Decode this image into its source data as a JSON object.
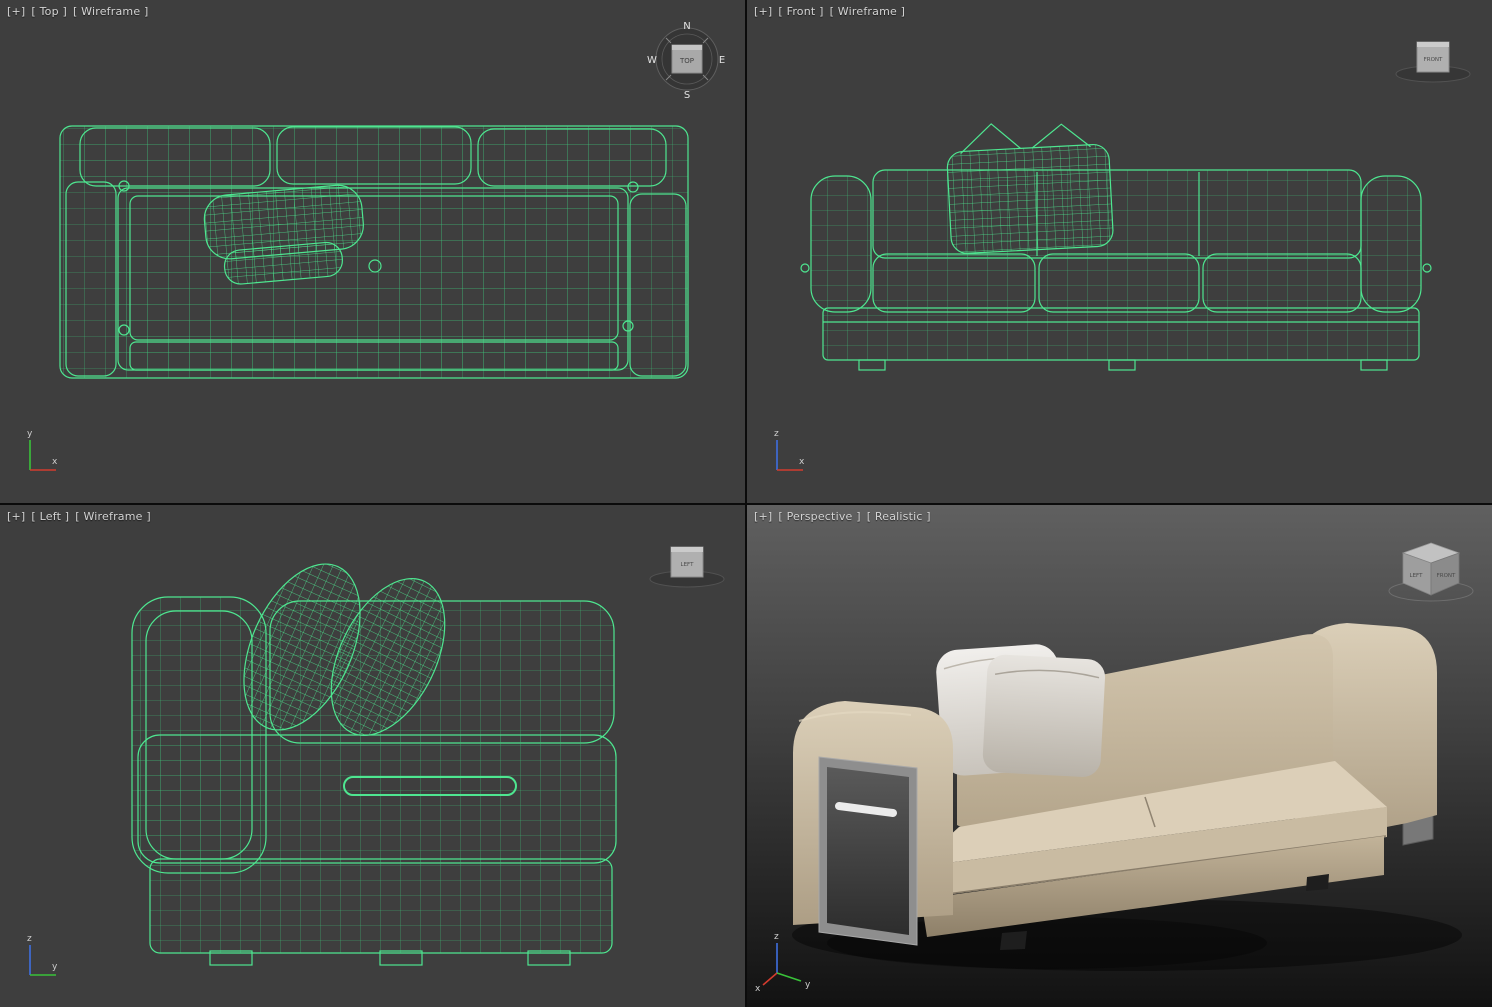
{
  "viewports": {
    "top": {
      "menu": "[+]",
      "view": "[ Top ]",
      "shading": "[ Wireframe ]"
    },
    "front": {
      "menu": "[+]",
      "view": "[ Front ]",
      "shading": "[ Wireframe ]"
    },
    "left": {
      "menu": "[+]",
      "view": "[ Left ]",
      "shading": "[ Wireframe ]"
    },
    "perspective": {
      "menu": "[+]",
      "view": "[ Perspective ]",
      "shading": "[ Realistic ]"
    }
  },
  "viewcube": {
    "top_face": "TOP",
    "front_face": "FRONT",
    "left_face": "LEFT",
    "persp_face_left": "LEFT",
    "persp_face_right": "FRONT",
    "compass": {
      "north": "N",
      "east": "E",
      "south": "S",
      "west": "W"
    }
  },
  "axes": {
    "x": "x",
    "y": "y",
    "z": "z"
  },
  "colors": {
    "wireframe_green": "#4ee690",
    "viewport_background": "#3e3e3e",
    "active_viewport_border": "#c09c35",
    "perspective_sky": "#5e5e5e",
    "sofa_fabric": "#cfc2aa",
    "pillow_white": "#eeece8",
    "tray_panel_dark": "#474747",
    "tray_frame_gray": "#8e8e8e"
  }
}
